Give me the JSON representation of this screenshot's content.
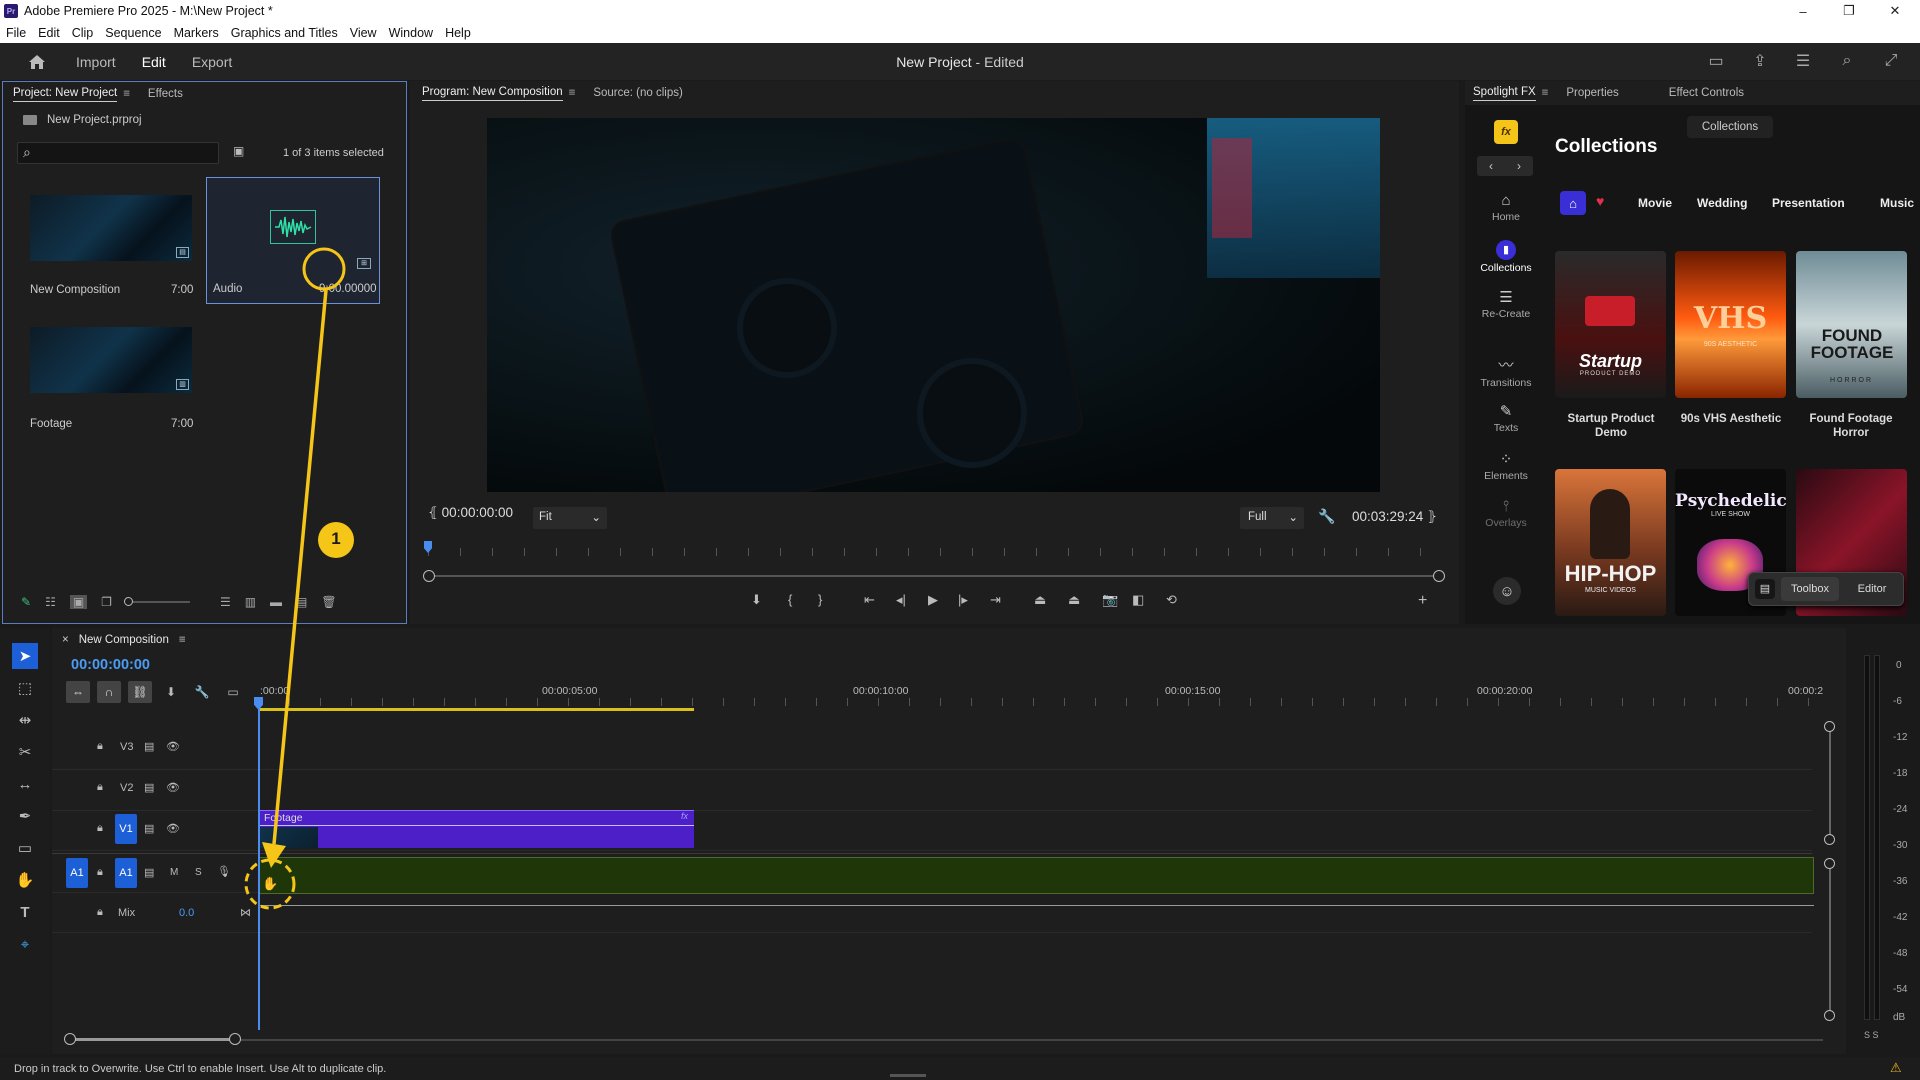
{
  "app": {
    "window_title": "Adobe Premiere Pro 2025 - M:\\New Project *",
    "logo": "Pr",
    "window_controls": [
      "–",
      "❐",
      "✕"
    ]
  },
  "menu": [
    "File",
    "Edit",
    "Clip",
    "Sequence",
    "Markers",
    "Graphics and Titles",
    "View",
    "Window",
    "Help"
  ],
  "topbar": {
    "tabs": [
      "Import",
      "Edit",
      "Export"
    ],
    "active_tab": "Edit",
    "project_name": "New Project",
    "project_state": " - Edited"
  },
  "project_panel": {
    "tabs": [
      "Project: New Project",
      "Effects"
    ],
    "file": "New Project.prproj",
    "search_placeholder": "",
    "selection_status": "1 of 3 items selected",
    "items": [
      {
        "name": "New Composition",
        "duration": "7:00"
      },
      {
        "name": "Audio",
        "duration": "9:00.00000"
      },
      {
        "name": "Footage",
        "duration": "7:00"
      }
    ]
  },
  "program_monitor": {
    "tabs": [
      "Program: New Composition",
      "Source: (no clips)"
    ],
    "timecode_in": "00:00:00:00",
    "zoom": "Fit",
    "quality": "Full",
    "timecode_out": "00:03:29:24"
  },
  "spotlight": {
    "tabs": [
      "Spotlight FX",
      "Properties",
      "Effect Controls"
    ],
    "fx_logo": "fx",
    "heading": "Collections",
    "collections_button": "Collections",
    "nav": [
      {
        "label": "Home",
        "icon": "home-icon"
      },
      {
        "label": "Collections",
        "icon": "collections-icon"
      },
      {
        "label": "Re-Create",
        "icon": "layers-icon"
      },
      {
        "label": "Transitions",
        "icon": "transitions-icon"
      },
      {
        "label": "Texts",
        "icon": "pen-icon"
      },
      {
        "label": "Elements",
        "icon": "elements-icon"
      },
      {
        "label": "Overlays",
        "icon": "overlays-icon"
      }
    ],
    "filters": [
      "Movie",
      "Wedding",
      "Presentation",
      "Music"
    ],
    "cards": [
      {
        "title": "Startup Product Demo",
        "art": "Startup",
        "art_sub": "PRODUCT DEMO"
      },
      {
        "title": "90s VHS Aesthetic",
        "art": "VHS",
        "art_sub": "90S AESTHETIC"
      },
      {
        "title": "Found Footage Horror",
        "art": "FOUND FOOTAGE",
        "art_sub": "HORROR"
      },
      {
        "title": "",
        "art": "HIP-HOP",
        "art_sub": "MUSIC VIDEOS"
      },
      {
        "title": "",
        "art": "Psychedelic",
        "art_sub": "LIVE SHOW"
      },
      {
        "title": "",
        "art": "",
        "art_sub": ""
      }
    ],
    "toolbox_label": "Toolbox",
    "editor_label": "Editor"
  },
  "timeline": {
    "sequence_name": "New Composition",
    "timecode": "00:00:00:00",
    "ruler": [
      ":00:00",
      "00:00:05:00",
      "00:00:10:00",
      "00:00:15:00",
      "00:00:20:00",
      "00:00:2"
    ],
    "tracks": [
      {
        "name": "V3"
      },
      {
        "name": "V2"
      },
      {
        "name": "V1"
      },
      {
        "name": "A1"
      }
    ],
    "track_buttons": {
      "mute": "M",
      "solo": "S"
    },
    "mix_label": "Mix",
    "mix_value": "0.0",
    "clip_label": "Footage",
    "step_badge": "1"
  },
  "meter": {
    "labels": [
      "0",
      "-6",
      "-12",
      "-18",
      "-24",
      "-30",
      "-36",
      "-42",
      "-48",
      "-54",
      "dB"
    ],
    "footer": "S S"
  },
  "status_text": "Drop in track to Overwrite. Use Ctrl to enable Insert. Use Alt to duplicate clip.",
  "colors": {
    "accent": "#1d5fd6",
    "clip_video": "#4c1fc9",
    "clip_audio": "#1f3608",
    "annotation": "#f5c518",
    "playhead": "#4a8cf0"
  }
}
